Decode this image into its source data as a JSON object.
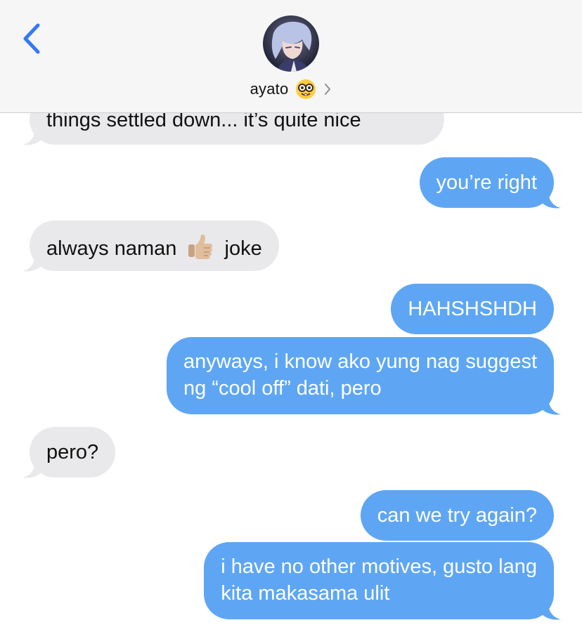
{
  "header": {
    "contact_name": "ayato",
    "contact_emoji_icon": "nerd-face-emoji",
    "back_icon": "chevron-left-icon",
    "chevron_icon": "chevron-right-icon"
  },
  "colors": {
    "incoming_bubble": "#e9e9eb",
    "outgoing_bubble": "#5ea6f3",
    "accent": "#3478f6"
  },
  "messages": [
    {
      "side": "incoming",
      "text": "things settled down... it’s quite nice"
    },
    {
      "side": "outgoing",
      "text": "you’re right"
    },
    {
      "side": "incoming",
      "text_before": "always naman",
      "emoji": "thumbs-up-emoji",
      "text_after": "joke"
    },
    {
      "side": "outgoing",
      "text": "HAHSHSHDH"
    },
    {
      "side": "outgoing",
      "lines": [
        "anyways, i know ako yung nag suggest",
        "ng “cool off” dati, pero"
      ]
    },
    {
      "side": "incoming",
      "text": "pero?"
    },
    {
      "side": "outgoing",
      "text": "can we try again?"
    },
    {
      "side": "outgoing",
      "lines": [
        "i have no other motives, gusto lang",
        "kita makasama ulit"
      ]
    }
  ]
}
